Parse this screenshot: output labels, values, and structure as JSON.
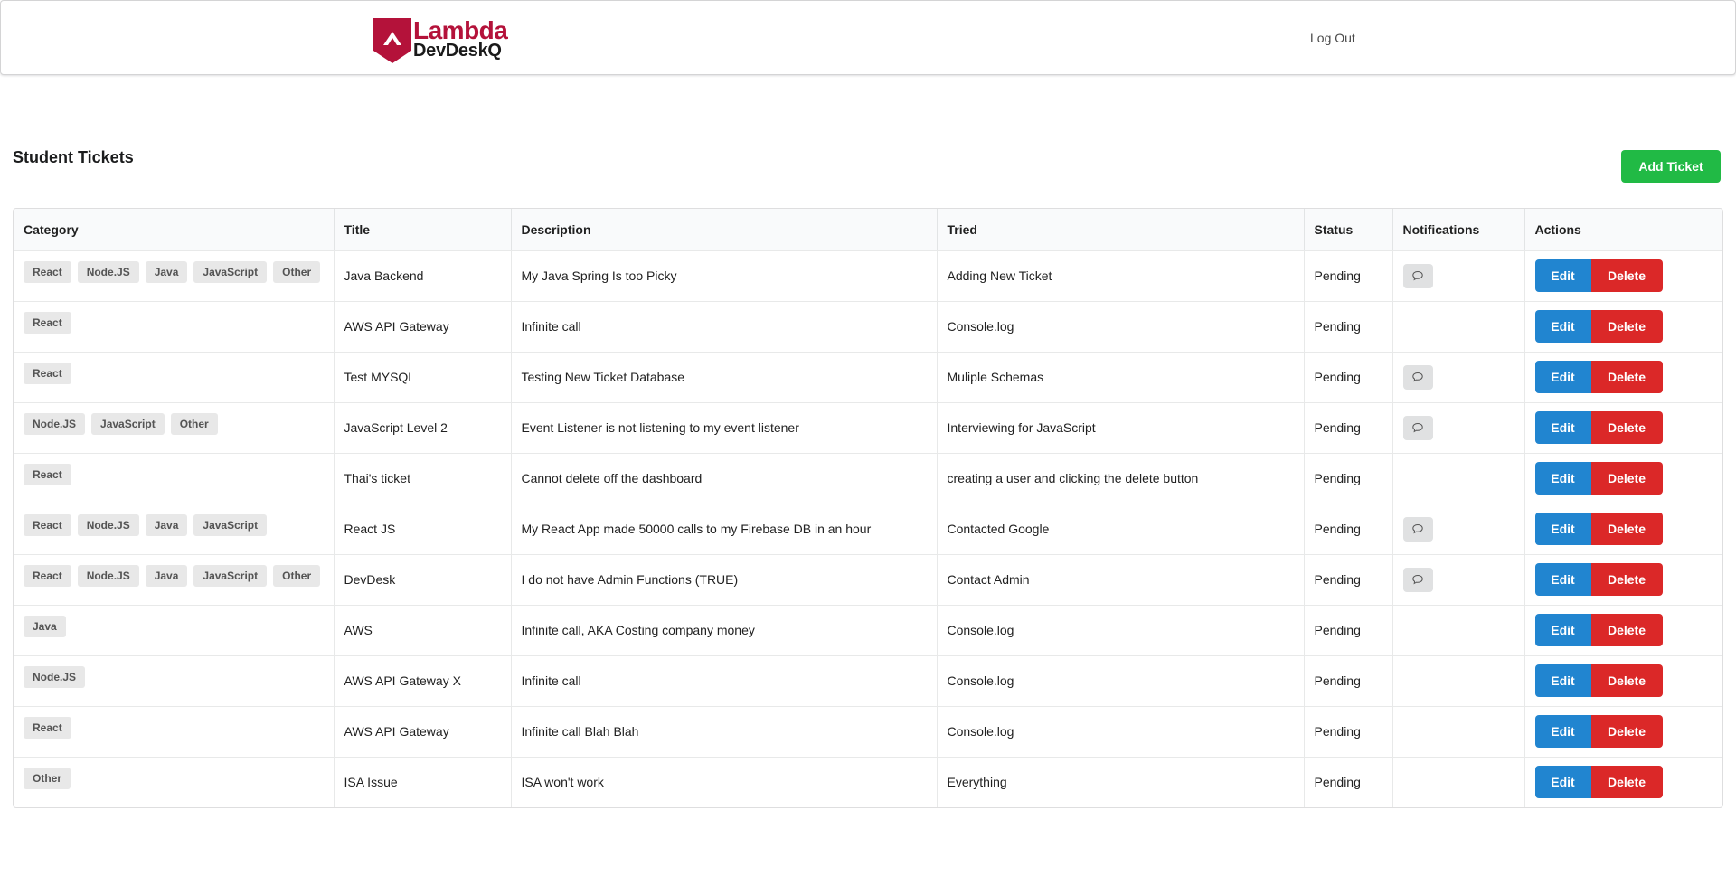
{
  "header": {
    "logo_line1": "Lambda",
    "logo_line2": "DevDeskQ",
    "logout_label": "Log Out"
  },
  "page_title": "Student Tickets",
  "add_ticket_label": "Add Ticket",
  "colors": {
    "brand": "#b4123a",
    "add": "#21ba45",
    "edit": "#2185d0",
    "delete": "#db2828"
  },
  "table": {
    "columns": [
      "Category",
      "Title",
      "Description",
      "Tried",
      "Status",
      "Notifications",
      "Actions"
    ],
    "edit_label": "Edit",
    "delete_label": "Delete",
    "rows": [
      {
        "categories": [
          "React",
          "Node.JS",
          "Java",
          "JavaScript",
          "Other"
        ],
        "title": "Java Backend",
        "description": "My Java Spring Is too Picky",
        "tried": "Adding New Ticket",
        "status": "Pending",
        "notification": true
      },
      {
        "categories": [
          "React"
        ],
        "title": "AWS API Gateway",
        "description": "Infinite call",
        "tried": "Console.log",
        "status": "Pending",
        "notification": false
      },
      {
        "categories": [
          "React"
        ],
        "title": "Test MYSQL",
        "description": "Testing New Ticket Database",
        "tried": "Muliple Schemas",
        "status": "Pending",
        "notification": true
      },
      {
        "categories": [
          "Node.JS",
          "JavaScript",
          "Other"
        ],
        "title": "JavaScript Level 2",
        "description": "Event Listener is not listening to my event listener",
        "tried": "Interviewing for JavaScript",
        "status": "Pending",
        "notification": true
      },
      {
        "categories": [
          "React"
        ],
        "title": "Thai's ticket",
        "description": "Cannot delete off the dashboard",
        "tried": "creating a user and clicking the delete button",
        "status": "Pending",
        "notification": false
      },
      {
        "categories": [
          "React",
          "Node.JS",
          "Java",
          "JavaScript"
        ],
        "title": "React JS",
        "description": "My React App made 50000 calls to my Firebase DB in an hour",
        "tried": "Contacted Google",
        "status": "Pending",
        "notification": true
      },
      {
        "categories": [
          "React",
          "Node.JS",
          "Java",
          "JavaScript",
          "Other"
        ],
        "title": "DevDesk",
        "description": "I do not have Admin Functions (TRUE)",
        "tried": "Contact Admin",
        "status": "Pending",
        "notification": true
      },
      {
        "categories": [
          "Java"
        ],
        "title": "AWS",
        "description": "Infinite call, AKA Costing company money",
        "tried": "Console.log",
        "status": "Pending",
        "notification": false
      },
      {
        "categories": [
          "Node.JS"
        ],
        "title": "AWS API Gateway X",
        "description": "Infinite call",
        "tried": "Console.log",
        "status": "Pending",
        "notification": false
      },
      {
        "categories": [
          "React"
        ],
        "title": "AWS API Gateway",
        "description": "Infinite call Blah Blah",
        "tried": "Console.log",
        "status": "Pending",
        "notification": false
      },
      {
        "categories": [
          "Other"
        ],
        "title": "ISA Issue",
        "description": "ISA won't work",
        "tried": "Everything",
        "status": "Pending",
        "notification": false
      }
    ]
  }
}
